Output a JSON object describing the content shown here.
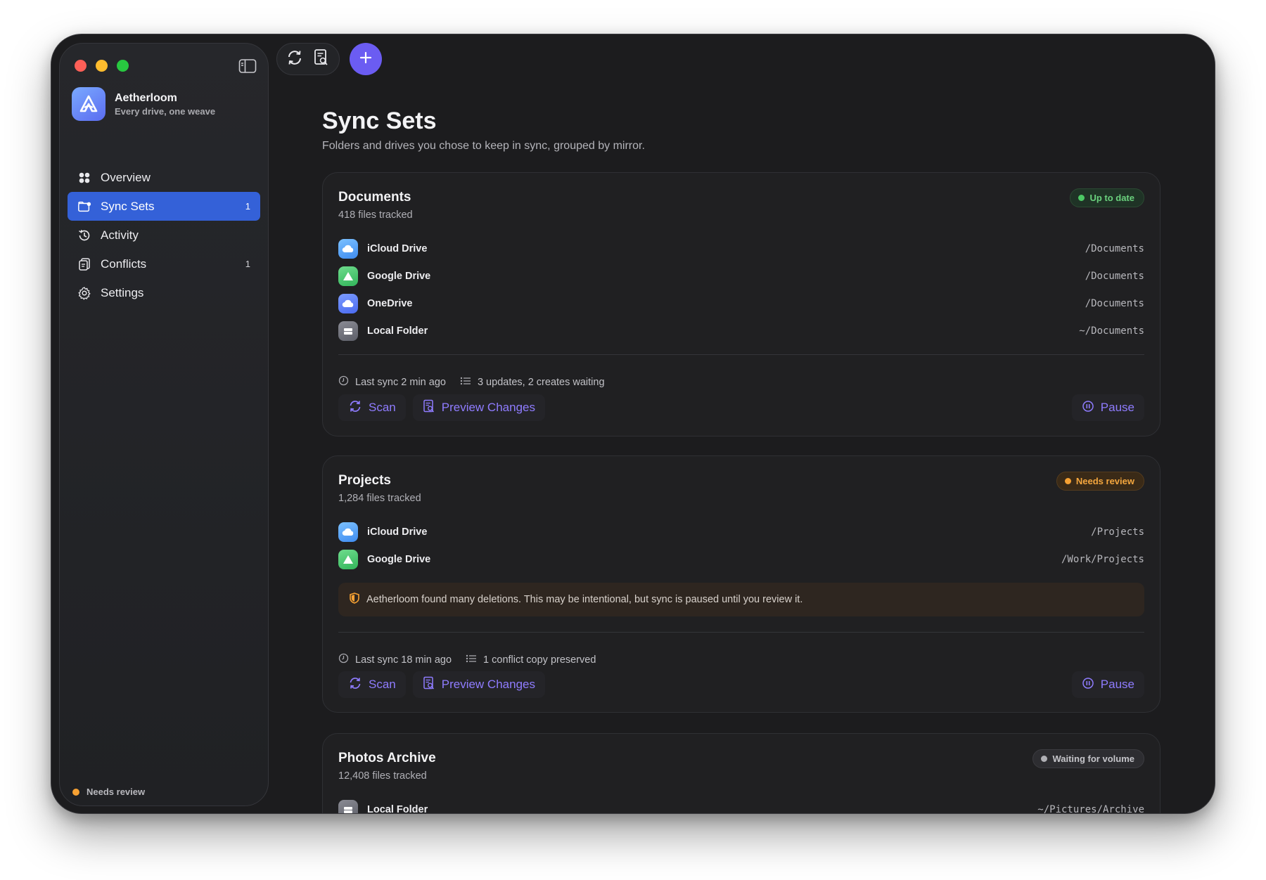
{
  "app": {
    "name": "Aetherloom",
    "tagline": "Every drive, one weave"
  },
  "sidebar": {
    "items": [
      {
        "label": "Overview",
        "count": "",
        "icon": "overview-icon"
      },
      {
        "label": "Sync Sets",
        "count": "1",
        "icon": "sync-sets-icon",
        "active": true
      },
      {
        "label": "Activity",
        "count": "",
        "icon": "history-icon"
      },
      {
        "label": "Conflicts",
        "count": "1",
        "icon": "conflicts-icon"
      },
      {
        "label": "Settings",
        "count": "",
        "icon": "gear-icon"
      }
    ],
    "footer_status": "Needs review"
  },
  "page": {
    "title": "Sync Sets",
    "subtitle": "Folders and drives you chose to keep in sync, grouped by mirror."
  },
  "actions": {
    "scan": "Scan",
    "preview": "Preview Changes",
    "pause": "Pause"
  },
  "sets": [
    {
      "title": "Documents",
      "files": "418 files tracked",
      "status": "Up to date",
      "mirrors": [
        {
          "name": "iCloud Drive",
          "path": "/Documents"
        },
        {
          "name": "Google Drive",
          "path": "/Documents"
        },
        {
          "name": "OneDrive",
          "path": "/Documents"
        },
        {
          "name": "Local Folder",
          "path": "~/Documents"
        }
      ],
      "last_sync": "Last sync 2 min ago",
      "pending": "3 updates, 2 creates waiting"
    },
    {
      "title": "Projects",
      "files": "1,284 files tracked",
      "status": "Needs review",
      "mirrors": [
        {
          "name": "iCloud Drive",
          "path": "/Projects"
        },
        {
          "name": "Google Drive",
          "path": "/Work/Projects"
        }
      ],
      "warning": "Aetherloom found many deletions. This may be intentional, but sync is paused until you review it.",
      "last_sync": "Last sync 18 min ago",
      "pending": "1 conflict copy preserved"
    },
    {
      "title": "Photos Archive",
      "files": "12,408 files tracked",
      "status": "Waiting for volume",
      "mirrors": [
        {
          "name": "Local Folder",
          "path": "~/Pictures/Archive"
        }
      ]
    }
  ],
  "colors": {
    "accent": "#6b5cf2",
    "active_nav": "#3461d8",
    "status_ok": "#4cc864",
    "status_review": "#f6a133",
    "status_waiting": "#b0b0b5"
  }
}
